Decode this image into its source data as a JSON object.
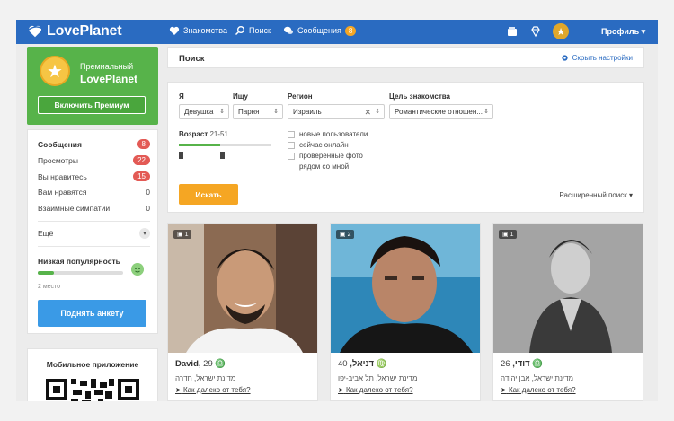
{
  "header": {
    "logo": "LovePlanet",
    "nav": [
      {
        "label": "Знакомства",
        "icon": "heart-icon"
      },
      {
        "label": "Поиск",
        "icon": "search-icon"
      },
      {
        "label": "Сообщения",
        "icon": "chat-icon",
        "badge": "8"
      }
    ],
    "profile_label": "Профиль"
  },
  "premium": {
    "line1": "Премиальный",
    "line2": "LovePlanet",
    "button": "Включить Премиум"
  },
  "menu": {
    "items": [
      {
        "label": "Сообщения",
        "value": "8",
        "style": "red"
      },
      {
        "label": "Просмотры",
        "value": "22",
        "style": "red"
      },
      {
        "label": "Вы нравитесь",
        "value": "15",
        "style": "red"
      },
      {
        "label": "Вам нравятся",
        "value": "0",
        "style": "plain"
      },
      {
        "label": "Взаимные симпатии",
        "value": "0",
        "style": "plain"
      }
    ],
    "more": "Ещё",
    "popularity_title": "Низкая популярность",
    "popularity_level": 0.19,
    "popularity_place": "2 место",
    "raise_button": "Поднять анкету"
  },
  "mobile": {
    "title": "Мобильное приложение"
  },
  "search": {
    "title": "Поиск",
    "hide_settings": "Скрыть настройки",
    "labels": {
      "me": "Я",
      "seek": "Ищу",
      "region": "Регион",
      "goal": "Цель знакомства",
      "age": "Возраст"
    },
    "values": {
      "me": "Девушка",
      "seek": "Парня",
      "region": "Израиль",
      "goal": "Романтические отношен...",
      "age": "21-51"
    },
    "checkboxes": [
      "новые пользователи",
      "сейчас онлайн",
      "проверенные фото",
      "рядом со мной"
    ],
    "button": "Искать",
    "advanced": "Расширенный поиск ▾"
  },
  "profiles": [
    {
      "name": "David,",
      "age": "29",
      "photos": "1",
      "city": "מדינת ישראל, חדרה",
      "distance": "Как далеко от тебя?"
    },
    {
      "name": "דניאל,",
      "age": "40",
      "photos": "2",
      "city": "מדינת ישראל, תל אביב-יפו",
      "distance": "Как далеко от тебя?"
    },
    {
      "name": "דודי,",
      "age": "26",
      "photos": "1",
      "city": "מדינת ישראל, אבן יהודה",
      "distance": "Как далеко от тебя?"
    }
  ]
}
